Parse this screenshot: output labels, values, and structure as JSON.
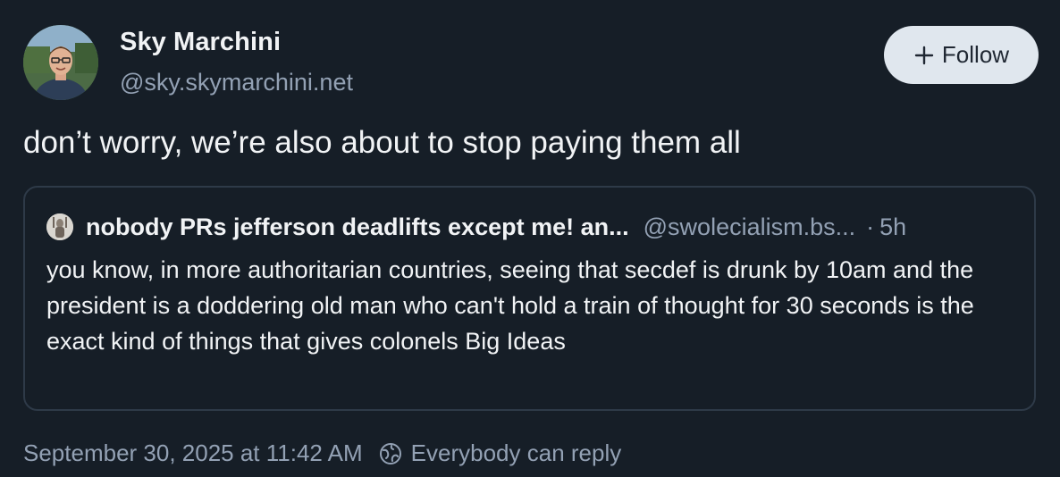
{
  "author": {
    "name": "Sky Marchini",
    "handle": "@sky.skymarchini.net"
  },
  "follow_button": {
    "label": "Follow",
    "icon": "plus-icon"
  },
  "post": {
    "text": "don’t worry, we’re also about to stop paying them all"
  },
  "quoted_post": {
    "author_name": "nobody PRs jefferson deadlifts except me! an...",
    "author_handle": "@swolecialism.bs...",
    "separator": "·",
    "time": "5h",
    "text": "you know, in more authoritarian countries, seeing that secdef is drunk by 10am and the president is a doddering old man who can't hold a train of thought for 30 seconds is the exact kind of things that gives colonels Big Ideas"
  },
  "footer": {
    "timestamp": "September 30, 2025 at 11:42 AM",
    "reply_setting": "Everybody can reply",
    "reply_icon": "globe-icon"
  },
  "colors": {
    "background": "#161e27",
    "text": "#f1f3f5",
    "muted": "#93a1b4",
    "follow_bg": "#e0e7ee",
    "quote_border": "#2e3a48"
  }
}
